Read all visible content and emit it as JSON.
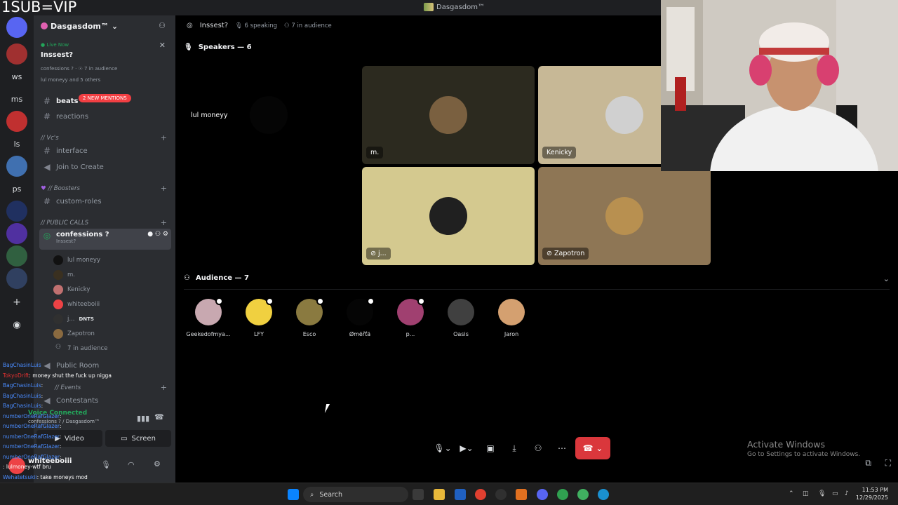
{
  "overlay": {
    "watermark": "1SUB=VIP"
  },
  "window": {
    "title": "Dasgasdom™"
  },
  "rail": {
    "servers": [
      {
        "label": "",
        "badge": "3",
        "color": "#5865f2"
      },
      {
        "label": "",
        "badge": "24",
        "color": "#a03030"
      },
      {
        "label": "ws",
        "badge": "",
        "color": "transparent"
      },
      {
        "label": "ms",
        "badge": "",
        "color": "transparent"
      },
      {
        "label": "",
        "badge": "",
        "color": "#c03030"
      },
      {
        "label": "ls",
        "badge": "",
        "color": "transparent"
      },
      {
        "label": "",
        "badge": "19",
        "color": "#4070b0"
      },
      {
        "label": "ps",
        "badge": "",
        "color": "transparent"
      },
      {
        "label": "",
        "badge": "",
        "color": "#203060"
      },
      {
        "label": "",
        "badge": "",
        "color": "#5030a0"
      },
      {
        "label": "",
        "badge": "2",
        "color": "#306040"
      },
      {
        "label": "",
        "badge": "11",
        "color": "#304060"
      }
    ],
    "add_server_icon": "plus-icon",
    "discover_icon": "compass-icon"
  },
  "sidebar": {
    "server_name": "Dasgasdom™",
    "live": {
      "status": "Live Now",
      "title": "Inssest?",
      "sub": "confessions ? · ☉ 7 in audience",
      "users": "lul moneyy and 5 others"
    },
    "mentions_badge": "2 NEW MENTIONS",
    "channels": {
      "beats": "beats",
      "reactions": "reactions",
      "vcs_category": "// Vc's",
      "interface": "interface",
      "join_to_create": "Join to Create",
      "boosters_category": "// Boosters",
      "custom_roles": "custom-roles",
      "public_calls_category": "// PUBLIC CALLS",
      "confessions": "confessions ?",
      "confessions_sub": "Inssest?",
      "public_room": "Public Room",
      "events_category": "// Events",
      "contestants": "Contestants"
    },
    "voice_users": [
      {
        "name": "lul moneyy",
        "color": "#111111",
        "tag": ""
      },
      {
        "name": "m.",
        "color": "#3a3020",
        "tag": ""
      },
      {
        "name": "Kenicky",
        "color": "#c07070",
        "tag": ""
      },
      {
        "name": "whiteeboiii",
        "color": "#ed4245",
        "tag": ""
      },
      {
        "name": "j...",
        "color": "#303030",
        "tag": "DNTS"
      },
      {
        "name": "Zapotron",
        "color": "#8a6a40",
        "tag": ""
      },
      {
        "name": "7 in audience",
        "color": "transparent",
        "tag": ""
      }
    ],
    "voice_panel": {
      "status": "Voice Connected",
      "path": "confessions ? / Dasgasdom™",
      "video_label": "Video",
      "screen_label": "Screen"
    },
    "user": {
      "name": "whiteeboiii"
    }
  },
  "chat_overlay": [
    {
      "name": "BagChasinLuis",
      "msg": "",
      "red": false
    },
    {
      "name": "TokyoDrift",
      "msg": ": money shut the fuck up nigga",
      "red": true
    },
    {
      "name": "BagChasinLuis",
      "msg": ":",
      "red": false
    },
    {
      "name": "BagChasinLuis",
      "msg": ":",
      "red": false
    },
    {
      "name": "BagChasinLuis",
      "msg": ":",
      "red": false
    },
    {
      "name": "numberOneRafGlazer",
      "msg": ":",
      "red": false
    },
    {
      "name": "numberOneRafGlazer",
      "msg": ":",
      "red": false
    },
    {
      "name": "numberOneRafGlazer",
      "msg": ":",
      "red": false
    },
    {
      "name": "numberOneRafGlazer",
      "msg": ":",
      "red": false
    },
    {
      "name": "numberOneRafGlazer",
      "msg": ":",
      "red": false
    },
    {
      "name": "",
      "msg": ": lulmoney-wtf bru",
      "red": false
    },
    {
      "name": "Wehatetsukii",
      "msg": ": take moneys mod",
      "red": false
    },
    {
      "name": "xiboxmonster",
      "msg": ": ",
      "red": true
    },
    {
      "name": "Wehatetsukii",
      "msg": ":",
      "red": false
    }
  ],
  "stage": {
    "title": "Inssest?",
    "speaking": "6 speaking",
    "audience_count": "7 in audience",
    "speakers_header": "Speakers — 6",
    "audience_header": "Audience — 7",
    "speakers": [
      {
        "name": "lul moneyy",
        "bg": "#000000",
        "av": "#050505",
        "muted": false
      },
      {
        "name": "m.",
        "bg": "#2c2a1f",
        "av": "#7a6040",
        "muted": false
      },
      {
        "name": "Kenicky",
        "bg": "#c7b896",
        "av": "#d0d0d0",
        "muted": false
      },
      {
        "name": "j...",
        "bg": "#d4c98f",
        "av": "#202020",
        "muted": true
      },
      {
        "name": "Zapotron",
        "bg": "#8e7655",
        "av": "#b89050",
        "muted": true
      }
    ],
    "audience": [
      {
        "name": "Geekedofmya...",
        "color": "#c8a8b0",
        "pip": true
      },
      {
        "name": "LFY",
        "color": "#f0d040",
        "pip": true
      },
      {
        "name": "Esco",
        "color": "#8a7a40",
        "pip": true
      },
      {
        "name": "Ømëřťä",
        "color": "#050505",
        "pip": true
      },
      {
        "name": "p...",
        "color": "#a04070",
        "pip": true
      },
      {
        "name": "Oasis",
        "color": "#404040",
        "pip": false
      },
      {
        "name": "Jaron",
        "color": "#d4a070",
        "pip": false
      }
    ]
  },
  "activation": {
    "line1": "Activate Windows",
    "line2": "Go to Settings to activate Windows."
  },
  "taskbar": {
    "search_placeholder": "Search",
    "time": "11:53 PM",
    "date": "12/29/2025"
  }
}
